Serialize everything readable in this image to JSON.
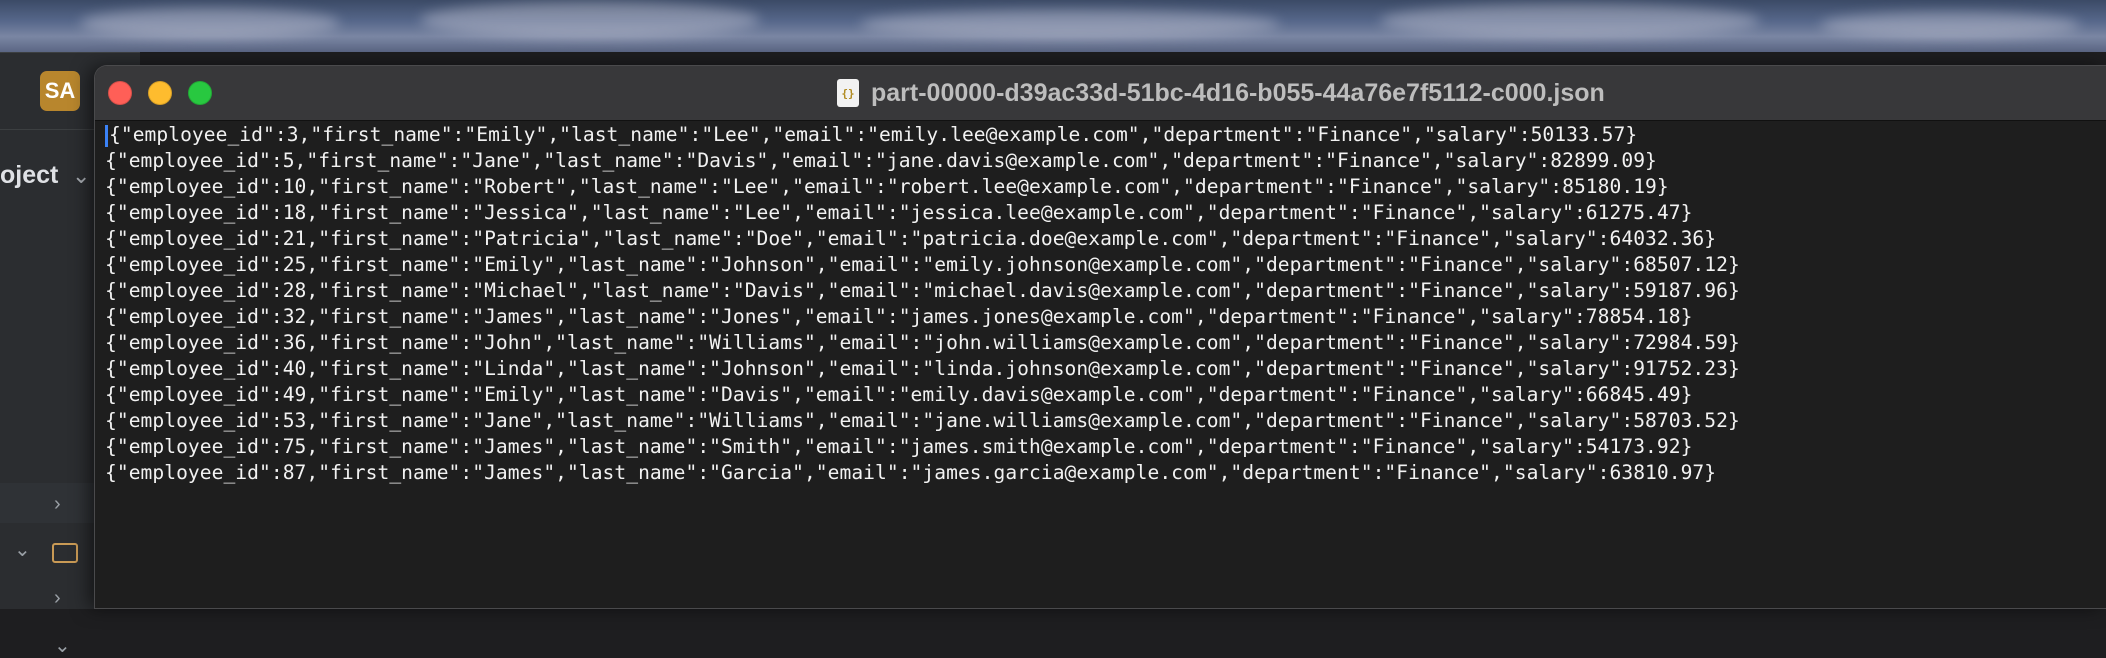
{
  "ide": {
    "avatar_initials": "SA",
    "project_label": "oject",
    "avatar_color": "#b8862d",
    "icons": [
      "chevron-down-icon",
      "chevron-right-icon",
      "folder-icon"
    ]
  },
  "window": {
    "title": "part-00000-d39ac33d-51bc-4d16-b055-44a76e7f5112-c000.json",
    "file_icon_glyph": "{}",
    "traffic_lights": {
      "close": "#ff5f57",
      "minimize": "#febc2e",
      "zoom": "#28c840"
    }
  },
  "lines": [
    "{\"employee_id\":3,\"first_name\":\"Emily\",\"last_name\":\"Lee\",\"email\":\"emily.lee@example.com\",\"department\":\"Finance\",\"salary\":50133.57}",
    "{\"employee_id\":5,\"first_name\":\"Jane\",\"last_name\":\"Davis\",\"email\":\"jane.davis@example.com\",\"department\":\"Finance\",\"salary\":82899.09}",
    "{\"employee_id\":10,\"first_name\":\"Robert\",\"last_name\":\"Lee\",\"email\":\"robert.lee@example.com\",\"department\":\"Finance\",\"salary\":85180.19}",
    "{\"employee_id\":18,\"first_name\":\"Jessica\",\"last_name\":\"Lee\",\"email\":\"jessica.lee@example.com\",\"department\":\"Finance\",\"salary\":61275.47}",
    "{\"employee_id\":21,\"first_name\":\"Patricia\",\"last_name\":\"Doe\",\"email\":\"patricia.doe@example.com\",\"department\":\"Finance\",\"salary\":64032.36}",
    "{\"employee_id\":25,\"first_name\":\"Emily\",\"last_name\":\"Johnson\",\"email\":\"emily.johnson@example.com\",\"department\":\"Finance\",\"salary\":68507.12}",
    "{\"employee_id\":28,\"first_name\":\"Michael\",\"last_name\":\"Davis\",\"email\":\"michael.davis@example.com\",\"department\":\"Finance\",\"salary\":59187.96}",
    "{\"employee_id\":32,\"first_name\":\"James\",\"last_name\":\"Jones\",\"email\":\"james.jones@example.com\",\"department\":\"Finance\",\"salary\":78854.18}",
    "{\"employee_id\":36,\"first_name\":\"John\",\"last_name\":\"Williams\",\"email\":\"john.williams@example.com\",\"department\":\"Finance\",\"salary\":72984.59}",
    "{\"employee_id\":40,\"first_name\":\"Linda\",\"last_name\":\"Johnson\",\"email\":\"linda.johnson@example.com\",\"department\":\"Finance\",\"salary\":91752.23}",
    "{\"employee_id\":49,\"first_name\":\"Emily\",\"last_name\":\"Davis\",\"email\":\"emily.davis@example.com\",\"department\":\"Finance\",\"salary\":66845.49}",
    "{\"employee_id\":53,\"first_name\":\"Jane\",\"last_name\":\"Williams\",\"email\":\"jane.williams@example.com\",\"department\":\"Finance\",\"salary\":58703.52}",
    "{\"employee_id\":75,\"first_name\":\"James\",\"last_name\":\"Smith\",\"email\":\"james.smith@example.com\",\"department\":\"Finance\",\"salary\":54173.92}",
    "{\"employee_id\":87,\"first_name\":\"James\",\"last_name\":\"Garcia\",\"email\":\"james.garcia@example.com\",\"department\":\"Finance\",\"salary\":63810.97}"
  ]
}
